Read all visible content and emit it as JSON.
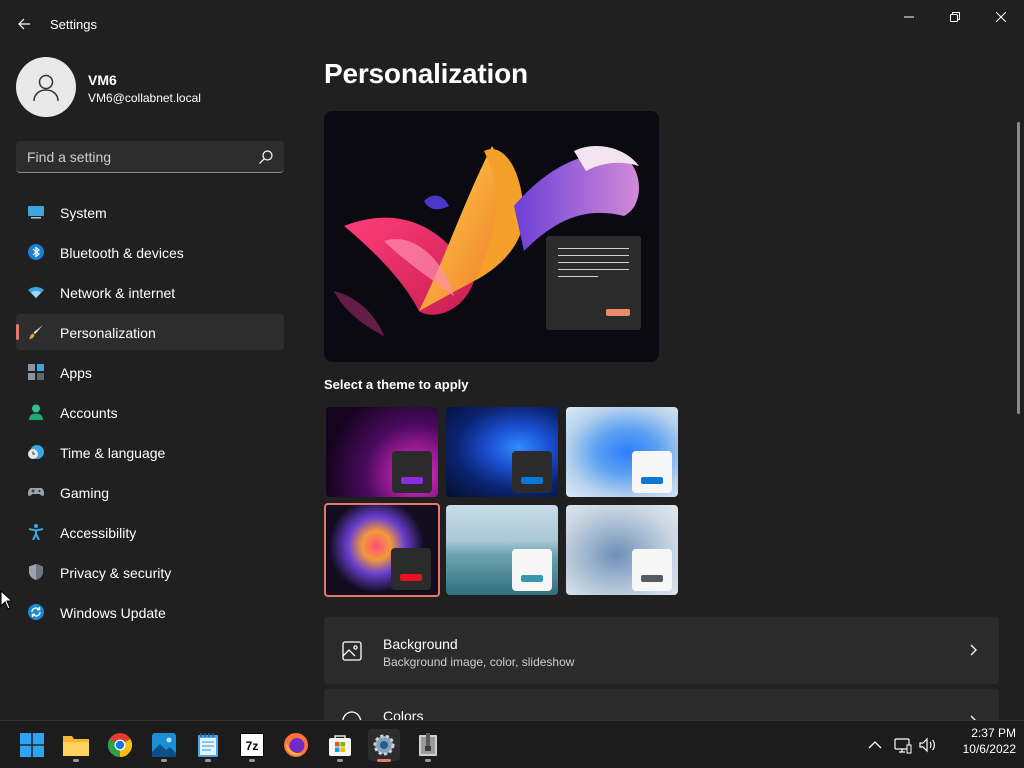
{
  "window": {
    "title": "Settings"
  },
  "profile": {
    "name": "VM6",
    "email": "VM6@collabnet.local"
  },
  "search": {
    "placeholder": "Find a setting"
  },
  "nav": [
    {
      "label": "System",
      "icon": "monitor-icon",
      "active": false
    },
    {
      "label": "Bluetooth & devices",
      "icon": "bluetooth-icon",
      "active": false
    },
    {
      "label": "Network & internet",
      "icon": "wifi-icon",
      "active": false
    },
    {
      "label": "Personalization",
      "icon": "brush-icon",
      "active": true
    },
    {
      "label": "Apps",
      "icon": "apps-icon",
      "active": false
    },
    {
      "label": "Accounts",
      "icon": "person-icon",
      "active": false
    },
    {
      "label": "Time & language",
      "icon": "clock-globe-icon",
      "active": false
    },
    {
      "label": "Gaming",
      "icon": "gamepad-icon",
      "active": false
    },
    {
      "label": "Accessibility",
      "icon": "accessibility-icon",
      "active": false
    },
    {
      "label": "Privacy & security",
      "icon": "shield-icon",
      "active": false
    },
    {
      "label": "Windows Update",
      "icon": "update-icon",
      "active": false
    }
  ],
  "main": {
    "title": "Personalization",
    "themes_label": "Select a theme to apply",
    "themes": [
      {
        "name": "theme-glow",
        "accent": "#8a2be2",
        "selected": false
      },
      {
        "name": "theme-dark-bloom",
        "accent": "#0a78d4",
        "selected": false
      },
      {
        "name": "theme-light-bloom",
        "accent": "#0a78d4",
        "selected": false
      },
      {
        "name": "theme-captured-motion",
        "accent": "#e81123",
        "selected": true
      },
      {
        "name": "theme-sunrise",
        "accent": "#3a96b0",
        "selected": false
      },
      {
        "name": "theme-flow",
        "accent": "#555c66",
        "selected": false
      }
    ],
    "cards": [
      {
        "title": "Background",
        "subtitle": "Background image, color, slideshow",
        "icon": "image-icon"
      },
      {
        "title": "Colors",
        "subtitle": "",
        "icon": "palette-icon"
      }
    ]
  },
  "taskbar": {
    "apps": [
      "start-icon",
      "file-explorer-icon",
      "chrome-icon",
      "photos-icon",
      "notepad-icon",
      "7zip-icon",
      "firefox-icon",
      "store-icon",
      "settings-icon",
      "archive-icon"
    ],
    "clock_time": "2:37 PM",
    "clock_date": "10/6/2022",
    "app_7zip_label": "7z"
  },
  "colors": {
    "accent": "#e8776b",
    "background": "#202020",
    "card": "#2b2b2b"
  }
}
